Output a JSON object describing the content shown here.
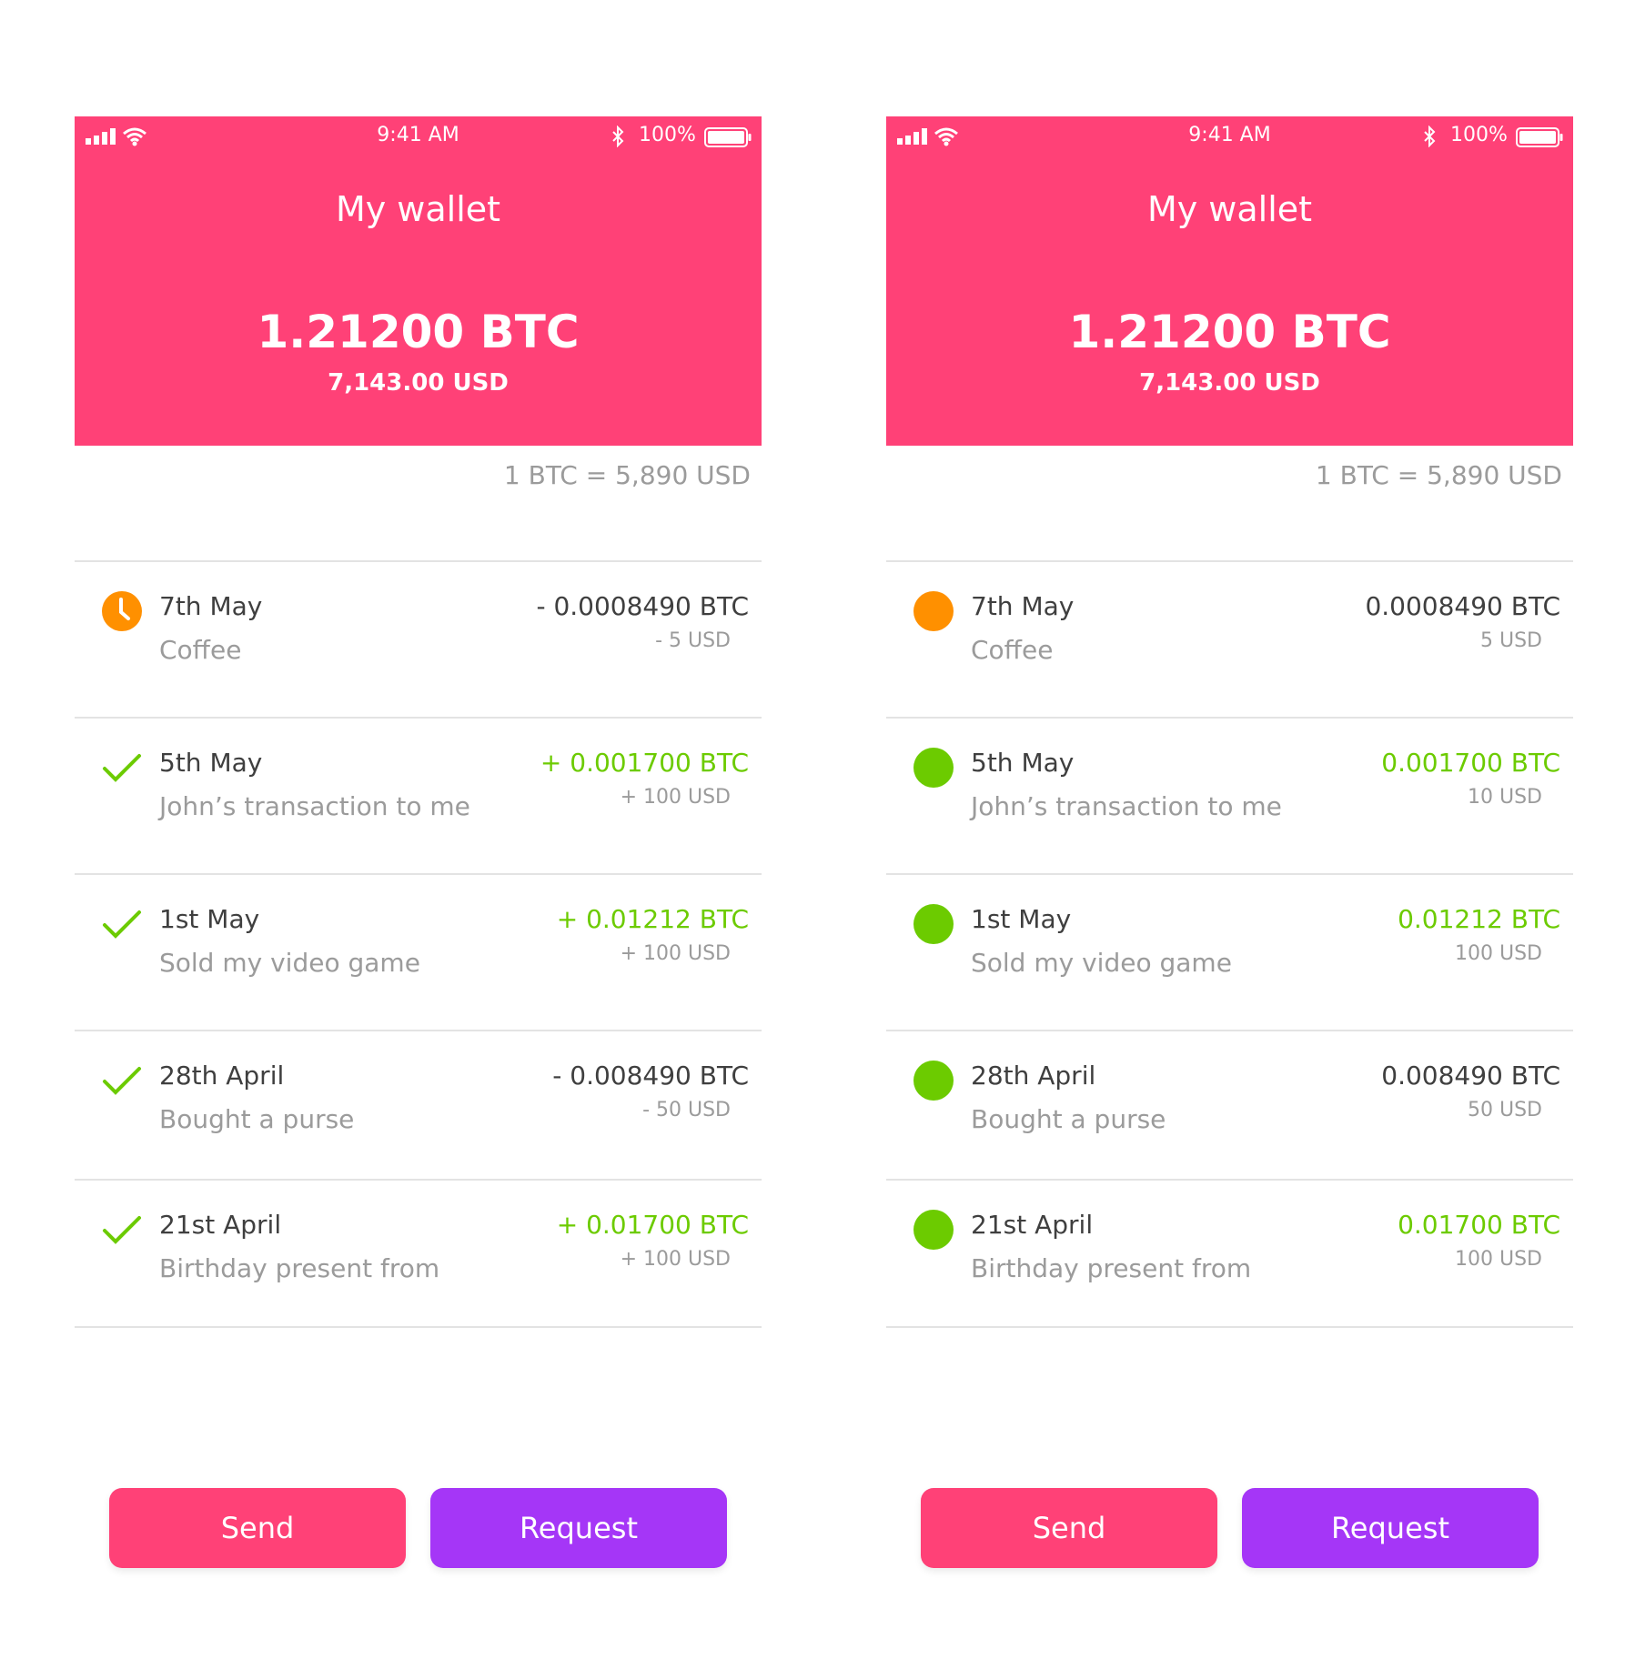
{
  "screens": [
    {
      "status": {
        "time": "9:41 AM",
        "battery": "100%"
      },
      "title": "My wallet",
      "balance_btc": "1.21200 BTC",
      "balance_usd": "7,143.00 USD",
      "rate": "1 BTC = 5,890 USD",
      "transactions": [
        {
          "date": "7th May",
          "description": "Coffee",
          "btc": "- 0.0008490 BTC",
          "usd": "- 5 USD",
          "icon": "clock-icon",
          "status_color": "#ff9000",
          "btc_color": "#3f3f3f"
        },
        {
          "date": "5th May",
          "description": "John’s transaction to me",
          "btc": "+ 0.001700 BTC",
          "usd": "+ 100 USD",
          "icon": "check-icon",
          "status_color": "#6ccb00",
          "btc_color": "#6ccb00"
        },
        {
          "date": "1st May",
          "description": "Sold my video game",
          "btc": "+ 0.01212 BTC",
          "usd": "+ 100 USD",
          "icon": "check-icon",
          "status_color": "#6ccb00",
          "btc_color": "#6ccb00"
        },
        {
          "date": "28th April",
          "description": "Bought a purse",
          "btc": "- 0.008490 BTC",
          "usd": "- 50 USD",
          "icon": "check-icon",
          "status_color": "#6ccb00",
          "btc_color": "#3f3f3f"
        },
        {
          "date": "21st April",
          "description": "Birthday present from",
          "btc": "+ 0.01700 BTC",
          "usd": "+ 100 USD",
          "icon": "check-icon",
          "status_color": "#6ccb00",
          "btc_color": "#6ccb00"
        }
      ],
      "buttons": {
        "send": "Send",
        "request": "Request"
      }
    },
    {
      "status": {
        "time": "9:41 AM",
        "battery": "100%"
      },
      "title": "My wallet",
      "balance_btc": "1.21200 BTC",
      "balance_usd": "7,143.00 USD",
      "rate": "1 BTC = 5,890 USD",
      "transactions": [
        {
          "date": "7th May",
          "description": "Coffee",
          "btc": "0.0008490 BTC",
          "usd": "5 USD",
          "icon": "status-dot-icon",
          "status_color": "#ff9000",
          "btc_color": "#3f3f3f"
        },
        {
          "date": "5th May",
          "description": "John’s transaction to me",
          "btc": "0.001700 BTC",
          "usd": "10 USD",
          "icon": "status-dot-icon",
          "status_color": "#6ccb00",
          "btc_color": "#6ccb00"
        },
        {
          "date": "1st May",
          "description": "Sold my video game",
          "btc": "0.01212 BTC",
          "usd": "100 USD",
          "icon": "status-dot-icon",
          "status_color": "#6ccb00",
          "btc_color": "#6ccb00"
        },
        {
          "date": "28th April",
          "description": "Bought a purse",
          "btc": "0.008490 BTC",
          "usd": "50 USD",
          "icon": "status-dot-icon",
          "status_color": "#6ccb00",
          "btc_color": "#3f3f3f"
        },
        {
          "date": "21st April",
          "description": "Birthday present from",
          "btc": "0.01700 BTC",
          "usd": "100 USD",
          "icon": "status-dot-icon",
          "status_color": "#6ccb00",
          "btc_color": "#6ccb00"
        }
      ],
      "buttons": {
        "send": "Send",
        "request": "Request"
      }
    }
  ],
  "colors": {
    "header": "#ff4177",
    "send_button": "#ff4177",
    "request_button": "#a536f7",
    "positive": "#6ccb00",
    "pending": "#ff9000"
  }
}
